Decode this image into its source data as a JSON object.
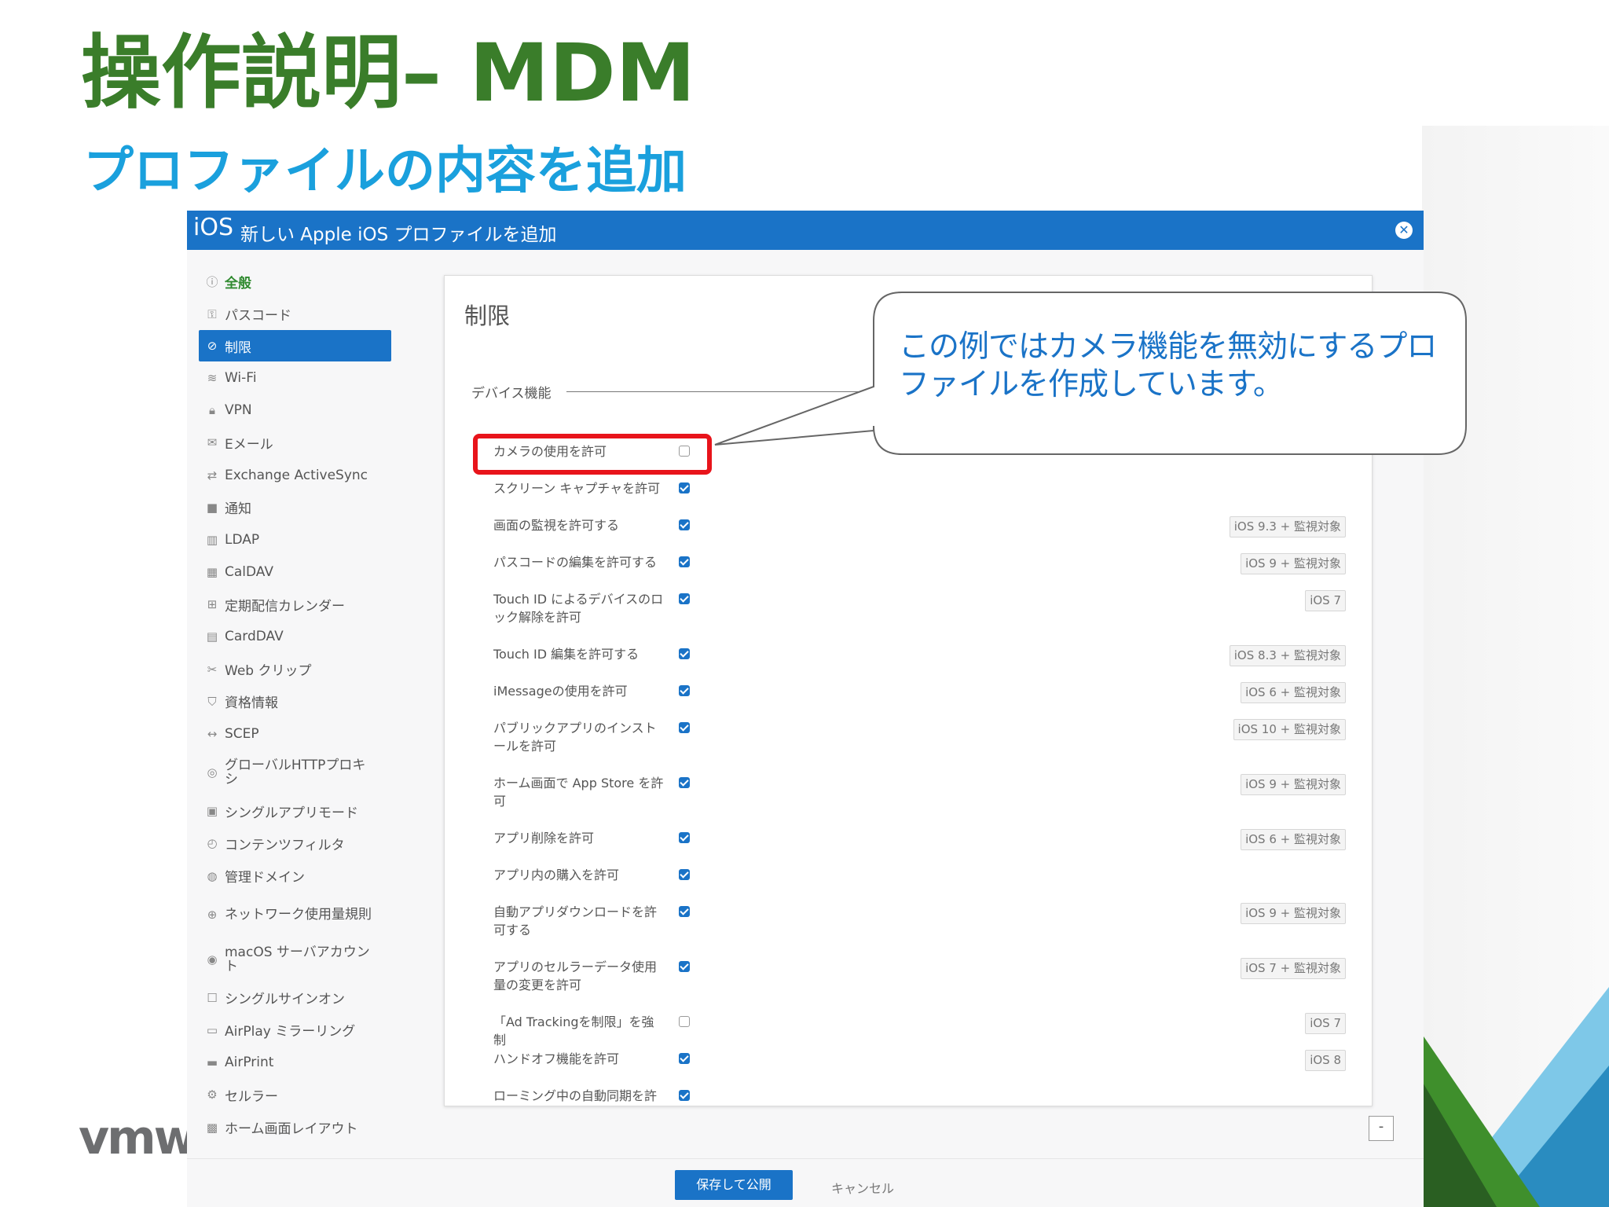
{
  "slide": {
    "title": "操作説明– MDM",
    "subtitle": "プロファイルの内容を追加",
    "logo": "vmw"
  },
  "dialog": {
    "platform": "iOS",
    "title": "新しい Apple iOS プロファイルを追加"
  },
  "sidebar": {
    "items": [
      {
        "label": "全般",
        "icon": "info-icon"
      },
      {
        "label": "パスコード",
        "icon": "key-icon"
      },
      {
        "label": "制限",
        "icon": "block-icon"
      },
      {
        "label": "Wi-Fi",
        "icon": "wifi-icon"
      },
      {
        "label": "VPN",
        "icon": "lock-icon"
      },
      {
        "label": "Eメール",
        "icon": "mail-icon"
      },
      {
        "label": "Exchange ActiveSync",
        "icon": "sync-icon"
      },
      {
        "label": "通知",
        "icon": "notification-icon"
      },
      {
        "label": "LDAP",
        "icon": "directory-icon"
      },
      {
        "label": "CalDAV",
        "icon": "calendar-icon"
      },
      {
        "label": "定期配信カレンダー",
        "icon": "calendar-add-icon"
      },
      {
        "label": "CardDAV",
        "icon": "contact-card-icon"
      },
      {
        "label": "Web クリップ",
        "icon": "scissors-icon"
      },
      {
        "label": "資格情報",
        "icon": "shield-icon"
      },
      {
        "label": "SCEP",
        "icon": "arrows-icon"
      },
      {
        "label": "グローバルHTTPプロキシ",
        "icon": "globe-icon"
      },
      {
        "label": "シングルアプリモード",
        "icon": "app-lock-icon"
      },
      {
        "label": "コンテンツフィルタ",
        "icon": "filter-icon"
      },
      {
        "label": "管理ドメイン",
        "icon": "domain-icon"
      },
      {
        "label": "ネットワーク使用量規則",
        "icon": "network-icon"
      },
      {
        "label": "macOS サーバアカウント",
        "icon": "server-icon"
      },
      {
        "label": "シングルサインオン",
        "icon": "sso-icon"
      },
      {
        "label": "AirPlay ミラーリング",
        "icon": "airplay-icon"
      },
      {
        "label": "AirPrint",
        "icon": "printer-icon"
      },
      {
        "label": "セルラー",
        "icon": "gear-icon"
      },
      {
        "label": "ホーム画面レイアウト",
        "icon": "home-layout-icon"
      }
    ]
  },
  "panel": {
    "title": "制限",
    "section": "デバイス機能",
    "settings": [
      {
        "label": "カメラの使用を許可",
        "checked": false,
        "badge": ""
      },
      {
        "label": "スクリーン キャプチャを許可",
        "checked": true,
        "badge": ""
      },
      {
        "label": "画面の監視を許可する",
        "checked": true,
        "badge": "iOS 9.3 + 監視対象"
      },
      {
        "label": "パスコードの編集を許可する",
        "checked": true,
        "badge": "iOS 9 + 監視対象"
      },
      {
        "label": "Touch ID によるデバイスのロック解除を許可",
        "checked": true,
        "badge": "iOS 7"
      },
      {
        "label": "Touch ID 編集を許可する",
        "checked": true,
        "badge": "iOS 8.3 + 監視対象"
      },
      {
        "label": "iMessageの使用を許可",
        "checked": true,
        "badge": "iOS 6 + 監視対象"
      },
      {
        "label": "パブリックアプリのインストールを許可",
        "checked": true,
        "badge": "iOS 10 + 監視対象"
      },
      {
        "label": "ホーム画面で App Store を許可",
        "checked": true,
        "badge": "iOS 9 + 監視対象"
      },
      {
        "label": "アプリ削除を許可",
        "checked": true,
        "badge": "iOS 6 + 監視対象"
      },
      {
        "label": "アプリ内の購入を許可",
        "checked": true,
        "badge": ""
      },
      {
        "label": "自動アプリダウンロードを許可する",
        "checked": true,
        "badge": "iOS 9 + 監視対象"
      },
      {
        "label": "アプリのセルラーデータ使用量の変更を許可",
        "checked": true,
        "badge": "iOS 7 + 監視対象"
      },
      {
        "label": "「Ad Trackingを制限」を強制",
        "checked": false,
        "badge": "iOS 7"
      },
      {
        "label": "ハンドオフ機能を許可",
        "checked": true,
        "badge": "iOS 8"
      },
      {
        "label": "ローミング中の自動同期を許",
        "checked": true,
        "badge": ""
      }
    ]
  },
  "callout": {
    "text": "この例ではカメラ機能を無効にするプロファイルを作成しています。"
  },
  "footer": {
    "save_label": "保存して公開",
    "cancel_label": "キャンセル",
    "collapse_label": "-"
  },
  "colors": {
    "title_green": "#3a7d2a",
    "subtitle_blue": "#1aa0dd",
    "accent_blue": "#1a73c7",
    "highlight_red": "#e8141b"
  }
}
